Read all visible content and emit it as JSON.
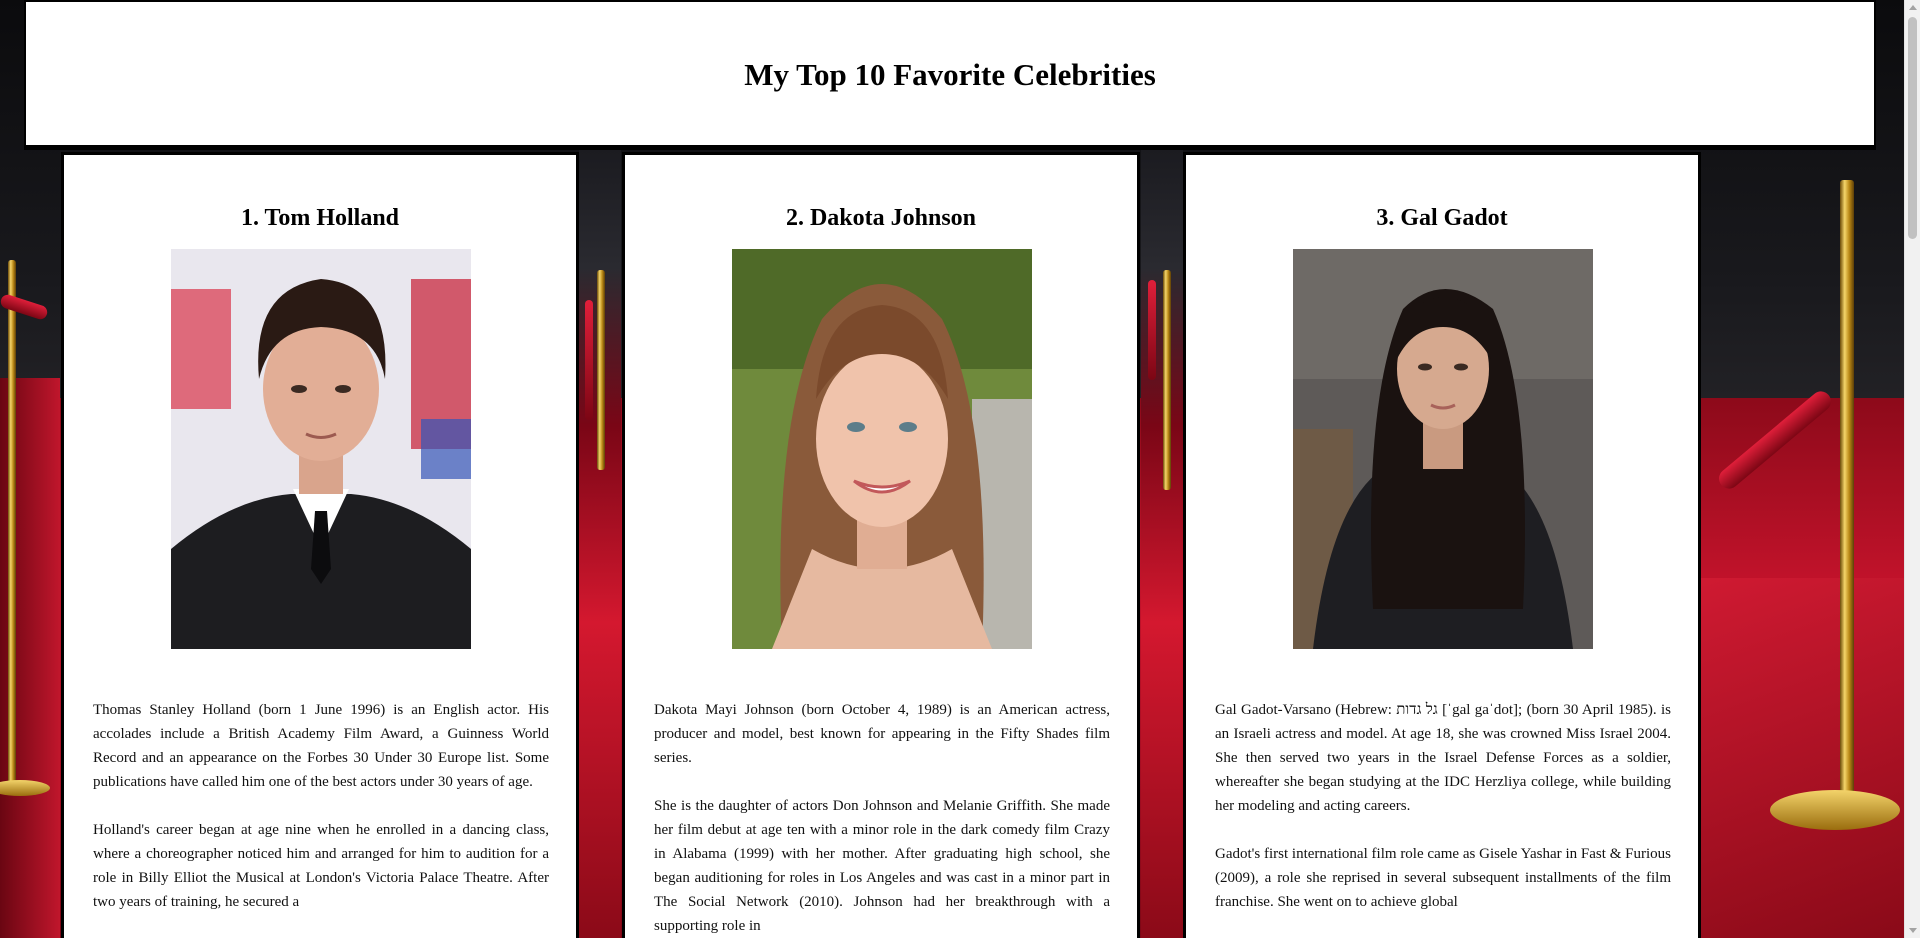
{
  "page": {
    "title": "My Top 10 Favorite Celebrities"
  },
  "celebrities": [
    {
      "heading": "1. Tom Holland",
      "photo_alt": "Tom Holland photo",
      "bio": [
        "Thomas Stanley Holland (born 1 June 1996) is an English actor. His accolades include a British Academy Film Award, a Guinness World Record and an appearance on the Forbes 30 Under 30 Europe list. Some publications have called him one of the best actors under 30 years of age.",
        "Holland's career began at age nine when he enrolled in a dancing class, where a choreographer noticed him and arranged for him to audition for a role in Billy Elliot the Musical at London's Victoria Palace Theatre. After two years of training, he secured a"
      ]
    },
    {
      "heading": "2. Dakota Johnson",
      "photo_alt": "Dakota Johnson photo",
      "bio": [
        "Dakota Mayi Johnson (born October 4, 1989) is an American actress, producer and model, best known for appearing in the Fifty Shades film series.",
        "She is the daughter of actors Don Johnson and Melanie Griffith. She made her film debut at age ten with a minor role in the dark comedy film Crazy in Alabama (1999) with her mother. After graduating high school, she began auditioning for roles in Los Angeles and was cast in a minor part in The Social Network (2010). Johnson had her breakthrough with a supporting role in"
      ]
    },
    {
      "heading": "3. Gal Gadot",
      "photo_alt": "Gal Gadot photo",
      "bio": [
        "Gal Gadot-Varsano (Hebrew: גל גדות [ˈgal gaˈdot]; (born 30 April 1985). is an Israeli actress and model. At age 18, she was crowned Miss Israel 2004. She then served two years in the Israel Defense Forces as a soldier, whereafter she began studying at the IDC Herzliya college, while building her modeling and acting careers.",
        "Gadot's first international film role came as Gisele Yashar in Fast & Furious (2009), a role she reprised in several subsequent installments of the film franchise. She went on to achieve global"
      ]
    }
  ]
}
